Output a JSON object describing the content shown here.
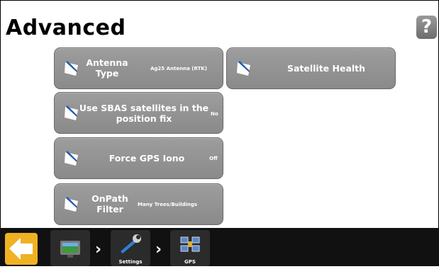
{
  "page": {
    "title": "Advanced",
    "help_glyph": "?"
  },
  "buttons": [
    {
      "label_lines": [
        "Antenna",
        "Type"
      ],
      "value": "Ag25 Antenna (RTK)",
      "icon": "edit-icon"
    },
    {
      "label_lines": [
        "Satellite Health"
      ],
      "value": "",
      "icon": "edit-icon"
    },
    {
      "label_lines": [
        "Use SBAS satellites in the",
        "position fix"
      ],
      "value": "No",
      "icon": "edit-icon"
    },
    {
      "label_lines": [
        "Force GPS Iono"
      ],
      "value": "Off",
      "icon": "edit-icon"
    },
    {
      "label_lines": [
        "OnPath",
        "Filter"
      ],
      "value": "Many Trees/Buildings",
      "icon": "edit-icon"
    }
  ],
  "nav": {
    "back_icon": "back-arrow-icon",
    "crumbs": [
      {
        "caption": "",
        "icon": "display-icon"
      },
      {
        "caption": "Settings",
        "icon": "wrench-icon"
      },
      {
        "caption": "GPS",
        "icon": "satellite-icon"
      }
    ],
    "separator": "›"
  },
  "colors": {
    "button": "#929292",
    "nav_bar": "#111111",
    "back_button": "#f0b223"
  }
}
